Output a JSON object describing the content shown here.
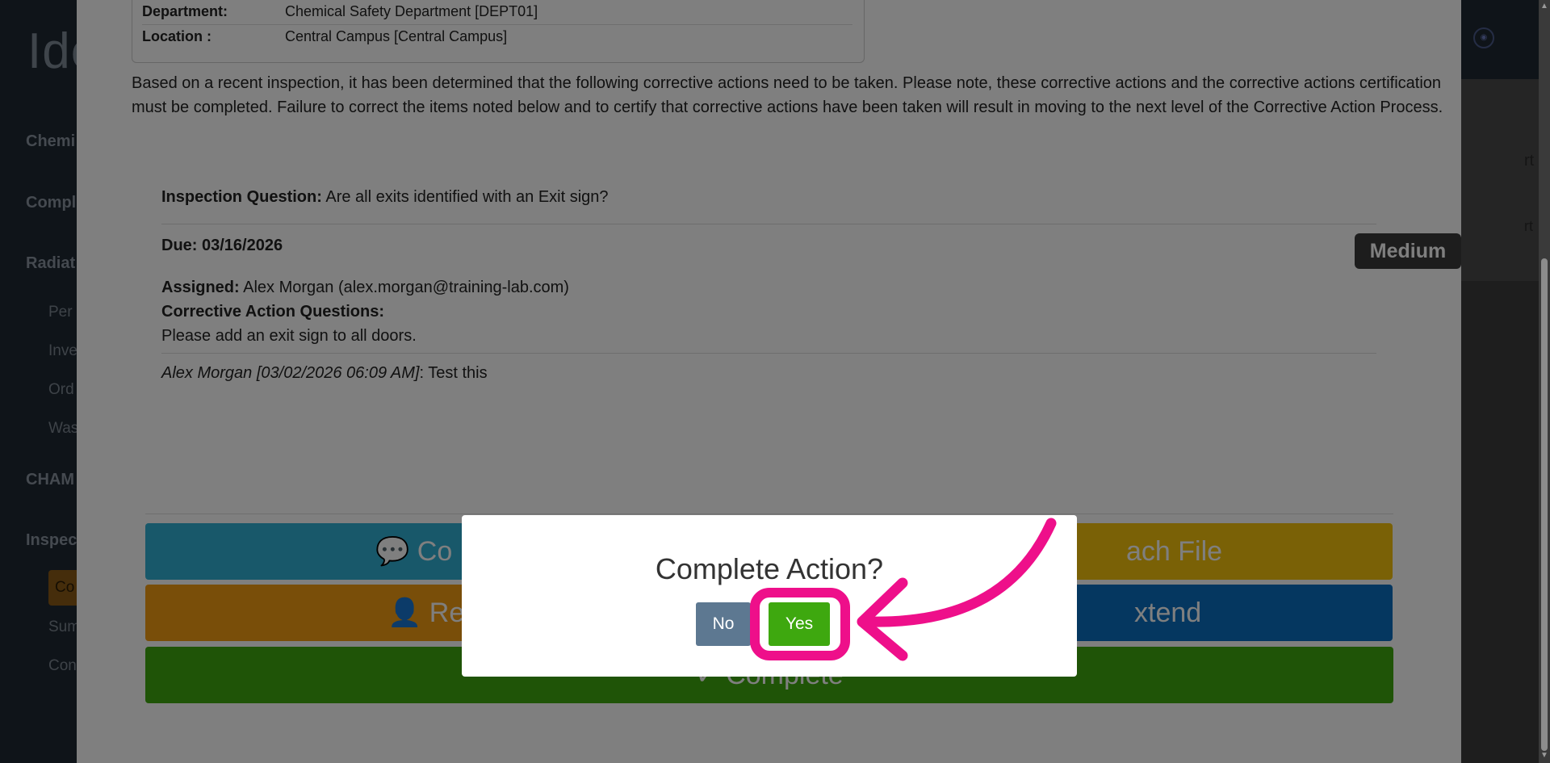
{
  "sidebar": {
    "logo": "Ide",
    "items": [
      {
        "label": "Chemi"
      },
      {
        "label": "Compl"
      },
      {
        "label": "Radiat"
      },
      {
        "label": "CHAM"
      },
      {
        "label": "Inspec"
      }
    ],
    "subitems": [
      {
        "label": "Per"
      },
      {
        "label": "Inve"
      },
      {
        "label": "Ord"
      },
      {
        "label": "Was"
      },
      {
        "label": "Sum"
      },
      {
        "label": "Con"
      }
    ],
    "active_item": "Co"
  },
  "right_panel": {
    "line1": "rt",
    "line2": "rt"
  },
  "info": {
    "department_label": "Department:",
    "department_value": "Chemical Safety Department [DEPT01]",
    "location_label": "Location :",
    "location_value": "Central Campus [Central Campus]"
  },
  "intro_text": "Based on a recent inspection, it has been determined that the following corrective actions need to be taken. Please note, these corrective actions and the corrective actions certification must be completed. Failure to correct the items noted below and to certify that corrective actions have been taken will result in moving to the next level of the Corrective Action Process.",
  "corrective_action": {
    "question_label": "Inspection Question:",
    "question_value": "Are all exits identified with an Exit sign?",
    "due": "Due: 03/16/2026",
    "priority": "Medium",
    "assigned_label": "Assigned:",
    "assigned_value": "Alex Morgan (alex.morgan@training-lab.com)",
    "questions_label": "Corrective Action Questions:",
    "questions_text": "Please add an exit sign to all doors.",
    "comment_author": "Alex Morgan [03/02/2026 06:09 AM]",
    "comment_text": ": Test this"
  },
  "actions": {
    "comment": "Co",
    "attach": "ach File",
    "reassign": "Rea",
    "extend": "xtend",
    "complete": "✓ Complete"
  },
  "confirm": {
    "title": "Complete Action?",
    "no_label": "No",
    "yes_label": "Yes"
  },
  "colors": {
    "highlight": "#ee0f8a",
    "yes": "#3ea80f",
    "no": "#5d7891"
  }
}
